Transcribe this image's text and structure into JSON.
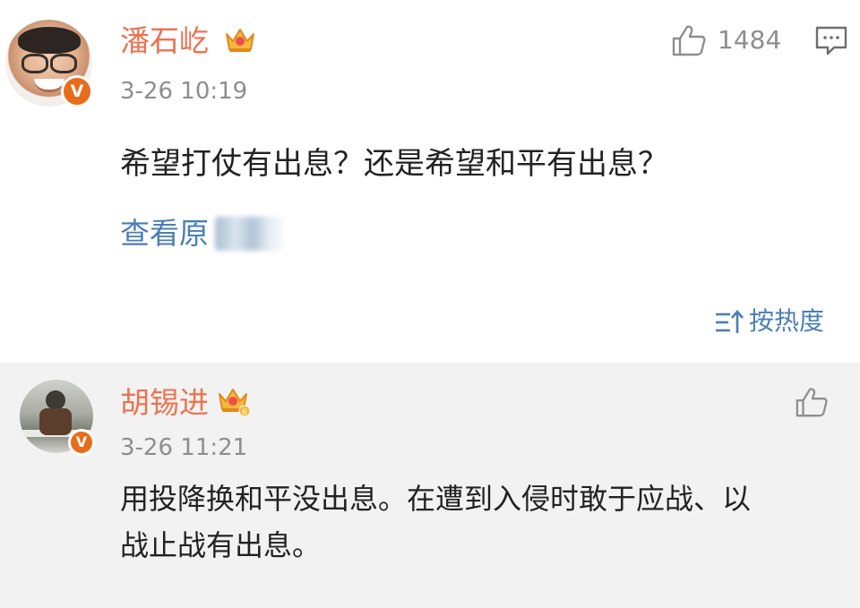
{
  "comment": {
    "username": "潘石屹",
    "timestamp": "3-26 10:19",
    "text": "希望打仗有出息？还是希望和平有出息？",
    "view_original_label": "查看原",
    "likes": "1484",
    "verified_badge": "V",
    "icons": [
      "crown-icon",
      "thumbs-up-icon",
      "reply-icon",
      "verified-icon"
    ]
  },
  "sort": {
    "label": "按热度",
    "icon": "sort-icon"
  },
  "reply": {
    "username": "胡锡进",
    "level_badge": "6",
    "timestamp": "3-26 11:21",
    "text_line1": "用投降换和平没出息。在遭到入侵时敢于应战、以",
    "text_line2": "战止战有出息。",
    "verified_badge": "V",
    "icons": [
      "crown-icon",
      "thumbs-up-icon",
      "verified-icon"
    ]
  },
  "colors": {
    "username": "#eb7350",
    "link": "#4a7fb3",
    "meta": "#8e8e8e",
    "badge": "#e86c1a",
    "reply_bg": "#f2f2f2"
  }
}
